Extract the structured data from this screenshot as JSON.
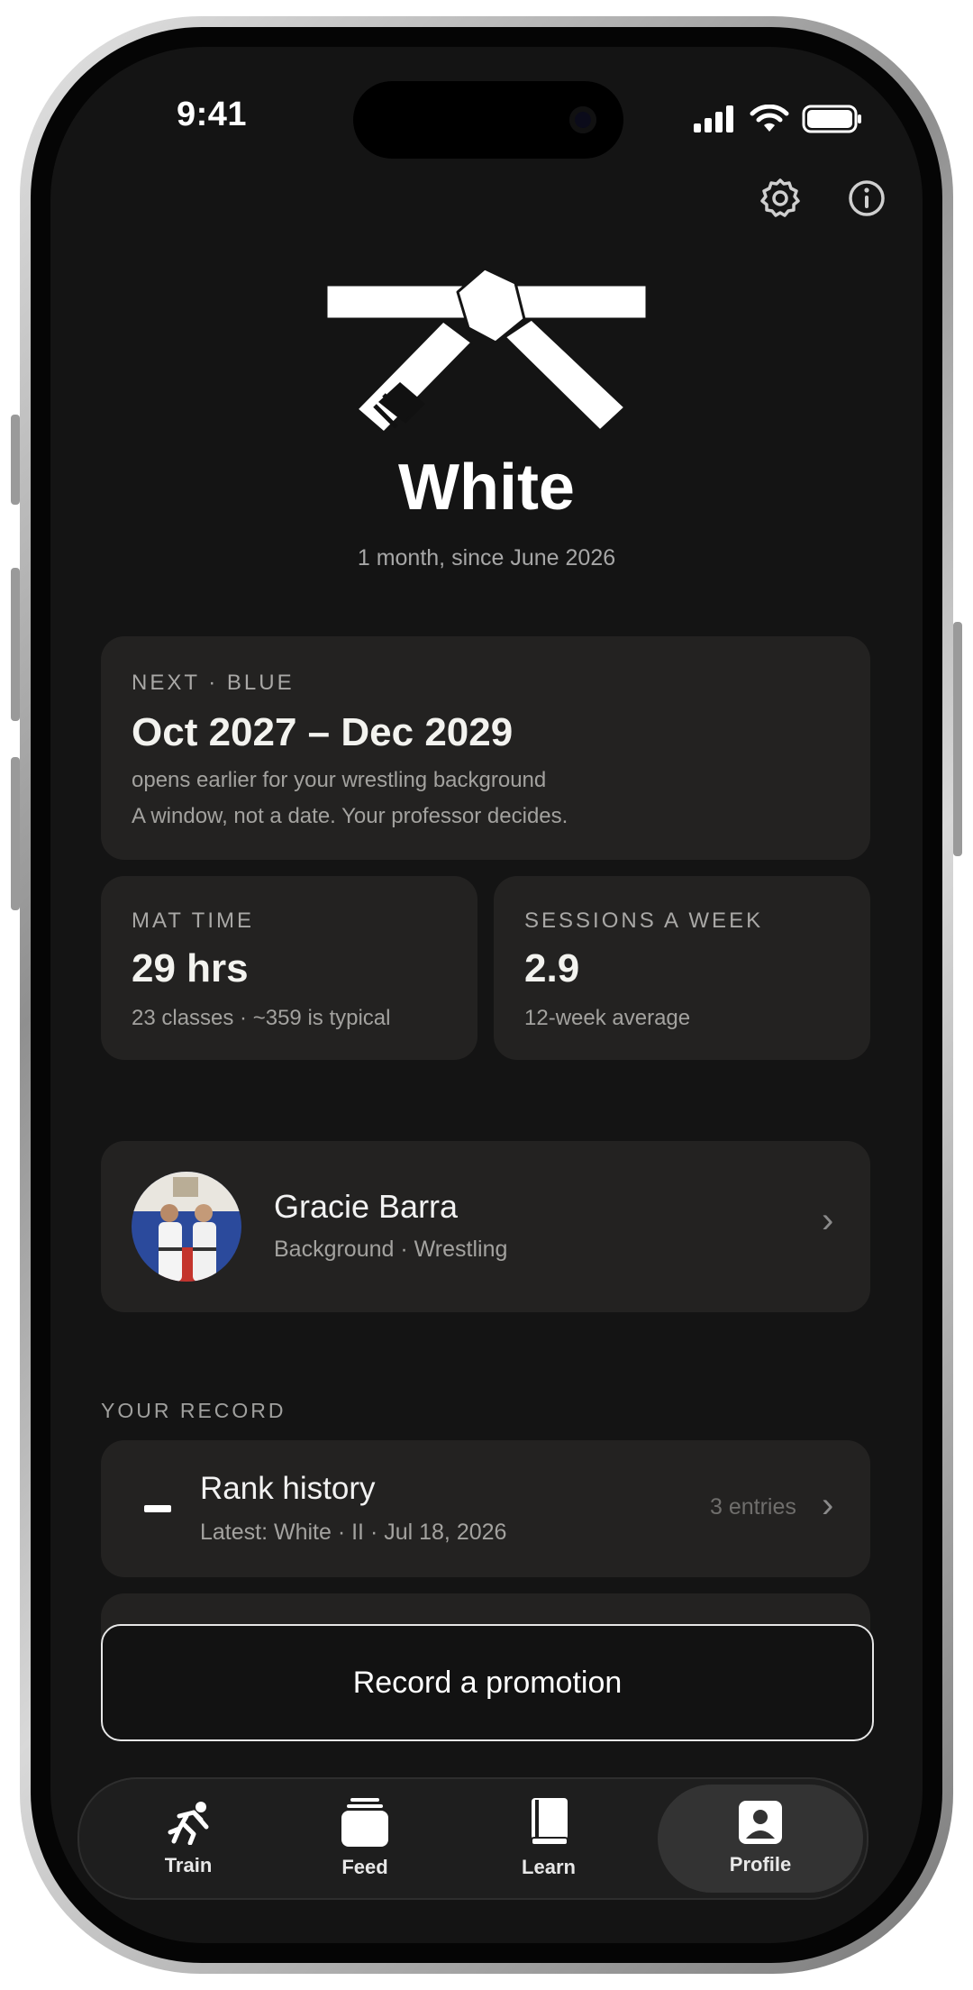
{
  "status_bar": {
    "time": "9:41"
  },
  "header": {
    "rank": "White",
    "tenure": "1 month, since June 2026"
  },
  "next_card": {
    "label": "NEXT · BLUE",
    "window": "Oct 2027 – Dec 2029",
    "note1": "opens earlier for your wrestling background",
    "note2": "A window, not a date. Your professor decides."
  },
  "stats": {
    "mat_time": {
      "label": "MAT TIME",
      "value": "29 hrs",
      "sub": "23 classes · ~359 is typical"
    },
    "sessions": {
      "label": "SESSIONS A WEEK",
      "value": "2.9",
      "sub": "12-week average"
    }
  },
  "gym": {
    "name": "Gracie Barra",
    "detail": "Background · Wrestling"
  },
  "record": {
    "section_label": "YOUR RECORD",
    "rank_history": {
      "title": "Rank history",
      "latest": "Latest: White · II · Jul 18, 2026",
      "count": "3 entries"
    }
  },
  "cta": {
    "label": "Record a promotion"
  },
  "tabs": [
    {
      "label": "Train",
      "icon": "wrestler-icon"
    },
    {
      "label": "Feed",
      "icon": "stack-icon"
    },
    {
      "label": "Learn",
      "icon": "book-icon"
    },
    {
      "label": "Profile",
      "icon": "profile-card-icon",
      "active": true
    }
  ],
  "colors": {
    "background": "#141414",
    "card": "#232221",
    "accent": "#ffffff"
  }
}
